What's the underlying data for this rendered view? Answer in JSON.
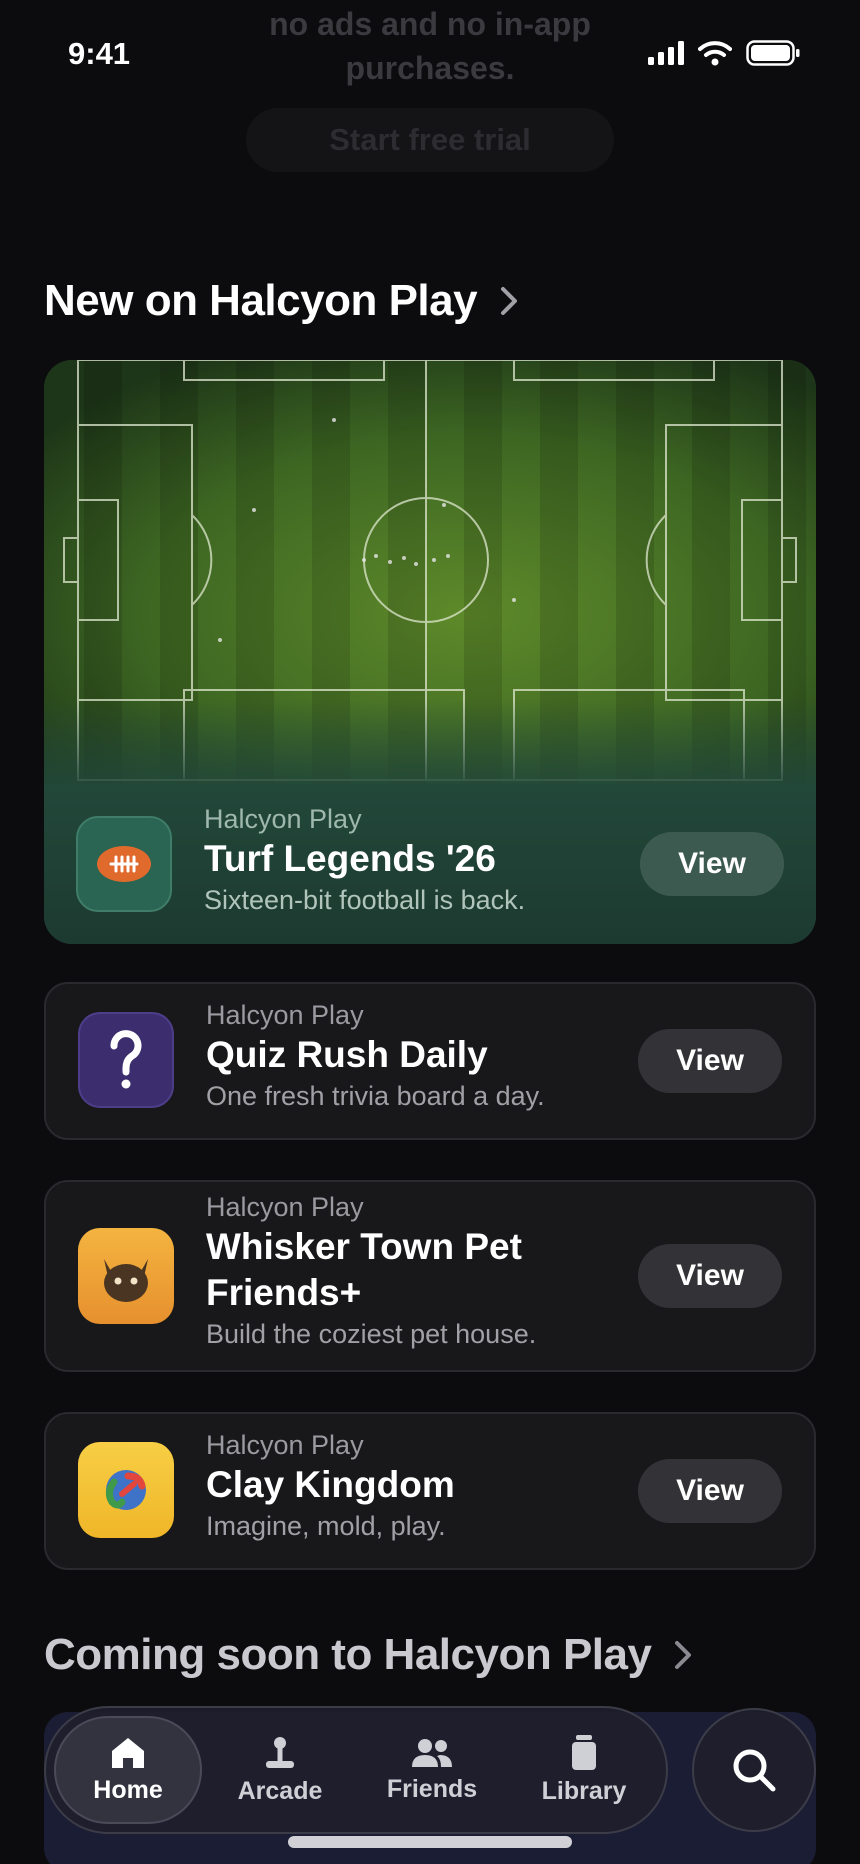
{
  "status": {
    "time": "9:41"
  },
  "promo": {
    "text": "no ads and no in-app purchases.",
    "trial_label": "Start free trial"
  },
  "sections": {
    "new": {
      "title": "New on Halcyon Play"
    },
    "coming": {
      "title": "Coming soon to Halcyon Play"
    }
  },
  "hero": {
    "publisher": "Halcyon Play",
    "name": "Turf Legends '26",
    "subtitle": "Sixteen-bit football is back.",
    "view_label": "View",
    "icon": "football-icon"
  },
  "apps": [
    {
      "publisher": "Halcyon Play",
      "name": "Quiz Rush Daily",
      "subtitle": "One fresh trivia board a day.",
      "view_label": "View",
      "icon": "question-mark-icon",
      "icon_color": "#3b2d6e"
    },
    {
      "publisher": "Halcyon Play",
      "name": "Whisker Town Pet Friends+",
      "subtitle": "Build the coziest pet house.",
      "view_label": "View",
      "icon": "cat-face-icon",
      "icon_color": "#eea33a"
    },
    {
      "publisher": "Halcyon Play",
      "name": "Clay Kingdom",
      "subtitle": "Imagine, mold, play.",
      "view_label": "View",
      "icon": "clay-ball-icon",
      "icon_color": "#f4c236"
    }
  ],
  "tabs": [
    {
      "label": "Home",
      "icon": "home-icon",
      "active": true
    },
    {
      "label": "Arcade",
      "icon": "joystick-icon",
      "active": false
    },
    {
      "label": "Friends",
      "icon": "people-icon",
      "active": false
    },
    {
      "label": "Library",
      "icon": "library-icon",
      "active": false
    }
  ],
  "search": {
    "icon": "search-icon"
  }
}
